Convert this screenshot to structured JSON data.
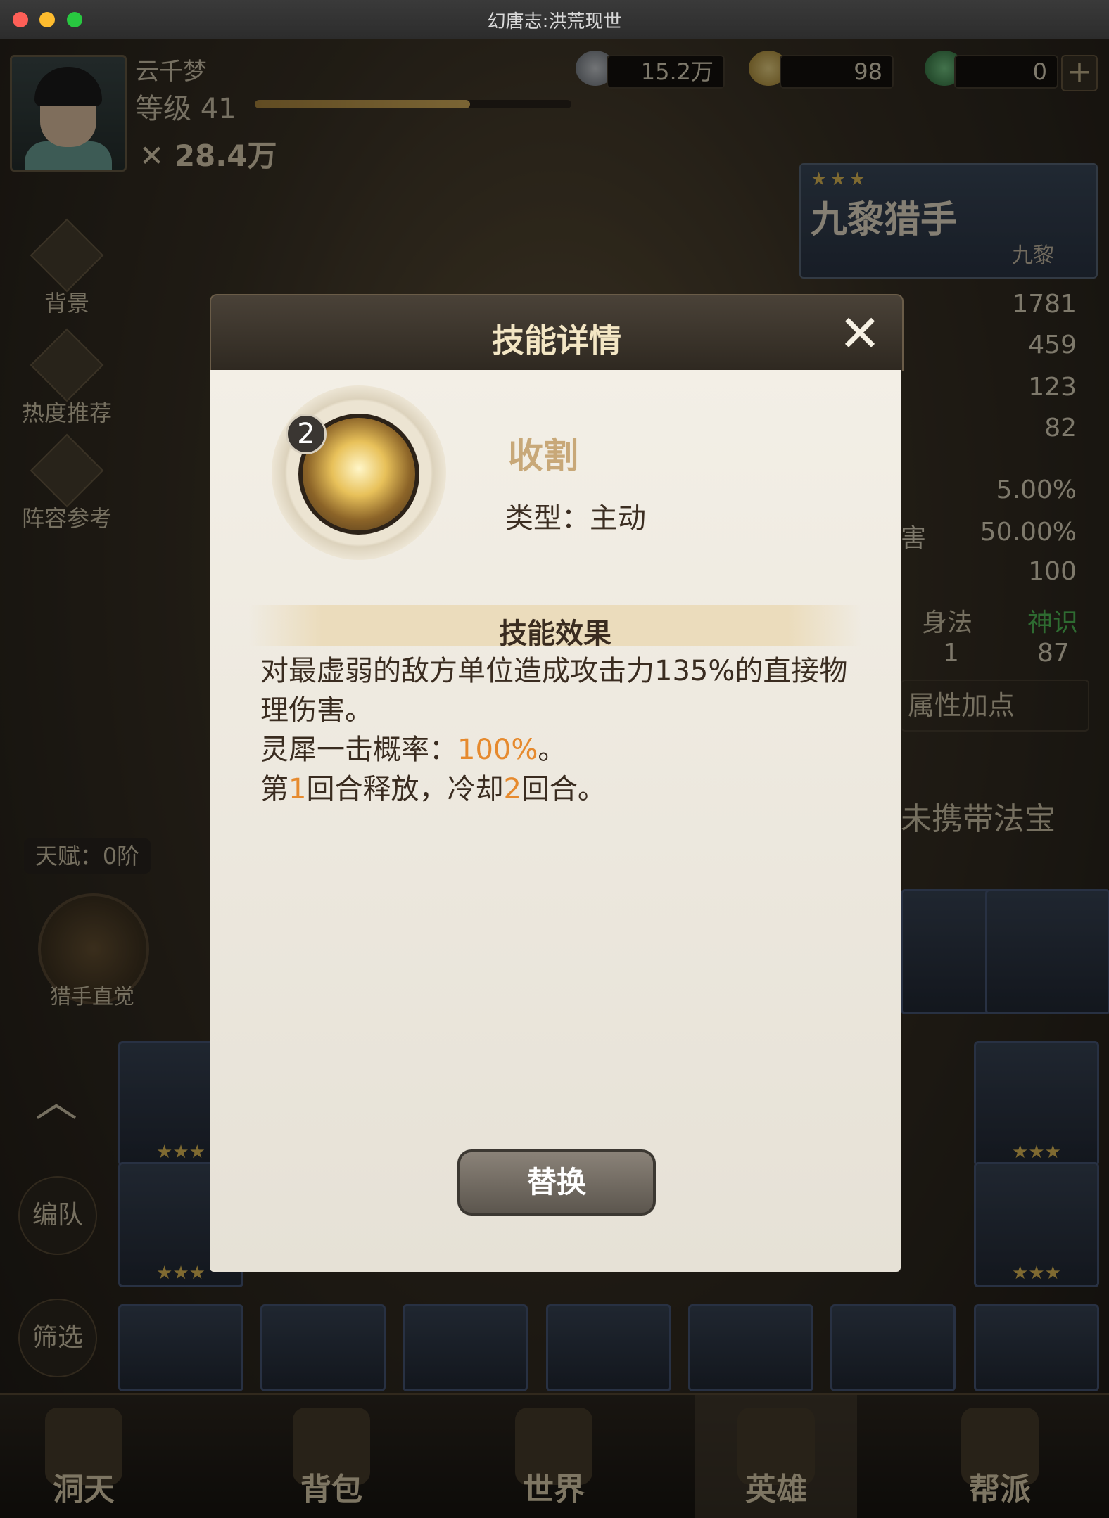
{
  "window": {
    "title": "幻唐志:洪荒现世"
  },
  "player": {
    "name": "云千梦",
    "level_label": "等级 41",
    "level_progress": 0.68,
    "power": "28.4万"
  },
  "resources": {
    "silver": "15.2万",
    "gold": "98",
    "jade": "0"
  },
  "side_menu": [
    {
      "label": "背景",
      "icon": "scroll-icon"
    },
    {
      "label": "热度推荐",
      "icon": "people-icon"
    },
    {
      "label": "阵容参考",
      "icon": "gear-icon"
    }
  ],
  "talent": {
    "label": "天赋：0阶",
    "skill_label": "猎手直觉"
  },
  "hero": {
    "stars": "★★★",
    "name": "九黎猎手",
    "faction": "九黎"
  },
  "stats": [
    "1781",
    "459",
    "123",
    "82",
    "5.00%",
    "50.00%",
    "100"
  ],
  "stat_partial_label": "害",
  "attrs": {
    "agility_label": "身法",
    "agility_value": "1",
    "spirit_label": "神识",
    "spirit_value": "87",
    "allocate_label": "属性加点"
  },
  "treasure_label": "未携带法宝",
  "buttons": {
    "formation": "编队",
    "filter": "筛选"
  },
  "bottom_tabs": [
    "洞天",
    "背包",
    "世界",
    "英雄",
    "帮派"
  ],
  "modal": {
    "title": "技能详情",
    "skill_level": "2",
    "skill_name": "收割",
    "skill_type": "类型：主动",
    "effect_header": "技能效果",
    "desc_line1": "对最虚弱的敌方单位造成攻击力135%的直接物理伤害。",
    "crit_prefix": "灵犀一击概率：",
    "crit_value": "100%",
    "crit_suffix": "。",
    "round_prefix": "第",
    "round_value": "1",
    "round_mid": "回合释放，冷却",
    "cooldown_value": "2",
    "round_suffix": "回合。",
    "replace_label": "替换"
  },
  "colors": {
    "highlight": "#e68a2e",
    "star": "#e8c25a"
  }
}
